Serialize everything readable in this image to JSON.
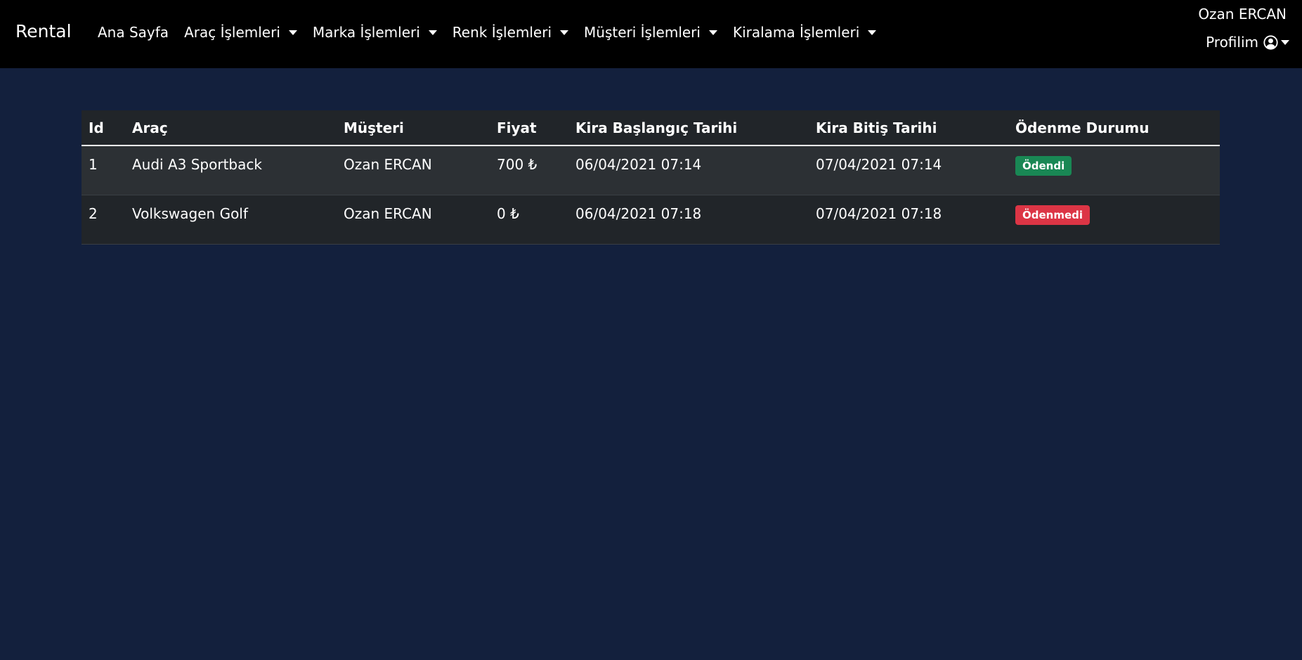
{
  "navbar": {
    "brand": "Rental",
    "items": [
      {
        "label": "Ana Sayfa",
        "dropdown": false
      },
      {
        "label": "Araç İşlemleri",
        "dropdown": true
      },
      {
        "label": "Marka İşlemleri",
        "dropdown": true
      },
      {
        "label": "Renk İşlemleri",
        "dropdown": true
      },
      {
        "label": "Müşteri İşlemleri",
        "dropdown": true
      },
      {
        "label": "Kiralama İşlemleri",
        "dropdown": true
      }
    ],
    "user_name": "Ozan ERCAN",
    "profile_label": "Profilim"
  },
  "table": {
    "headers": {
      "id": "Id",
      "car": "Araç",
      "customer": "Müşteri",
      "price": "Fiyat",
      "start": "Kira Başlangıç Tarihi",
      "end": "Kira Bitiş Tarihi",
      "status": "Ödenme Durumu"
    },
    "rows": [
      {
        "id": "1",
        "car": "Audi A3 Sportback",
        "customer": "Ozan ERCAN",
        "price": "700 ₺",
        "start": "06/04/2021 07:14",
        "end": "07/04/2021 07:14",
        "status": "Ödendi",
        "status_color": "#198754"
      },
      {
        "id": "2",
        "car": "Volkswagen Golf",
        "customer": "Ozan ERCAN",
        "price": "0 ₺",
        "start": "06/04/2021 07:18",
        "end": "07/04/2021 07:18",
        "status": "Ödenmedi",
        "status_color": "#dc3545"
      }
    ]
  },
  "colors": {
    "navbar_bg": "#000000",
    "page_bg": "#13203d",
    "table_bg": "#212529"
  }
}
